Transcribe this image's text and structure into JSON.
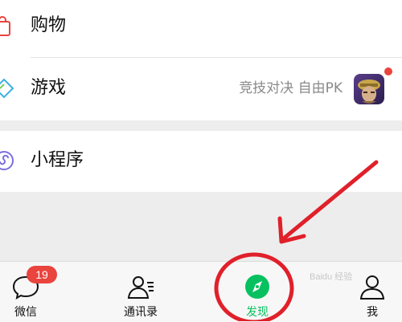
{
  "rows": {
    "shopping": {
      "label": "购物",
      "icon": "shopping-bag-icon"
    },
    "games": {
      "label": "游戏",
      "subtitle": "竞技对决 自由PK",
      "icon": "game-diamond-icon",
      "thumbnail": "game-avatar-image",
      "has_red_dot": true
    },
    "mini_programs": {
      "label": "小程序",
      "icon": "mini-program-icon"
    }
  },
  "tabbar": {
    "chats": {
      "label": "微信",
      "badge": "19",
      "icon": "chat-bubble-icon"
    },
    "contacts": {
      "label": "通讯录",
      "icon": "contacts-icon"
    },
    "discover": {
      "label": "发现",
      "icon": "compass-icon",
      "active": true
    },
    "me": {
      "label": "我",
      "icon": "person-icon"
    }
  },
  "colors": {
    "active_green": "#07c160",
    "badge_red": "#e9443d",
    "annotation_red": "#e0202a",
    "background": "#ededed"
  },
  "annotation": {
    "type": "red circle and arrow highlighting the Discover tab"
  },
  "watermark": "Baidu 经验"
}
